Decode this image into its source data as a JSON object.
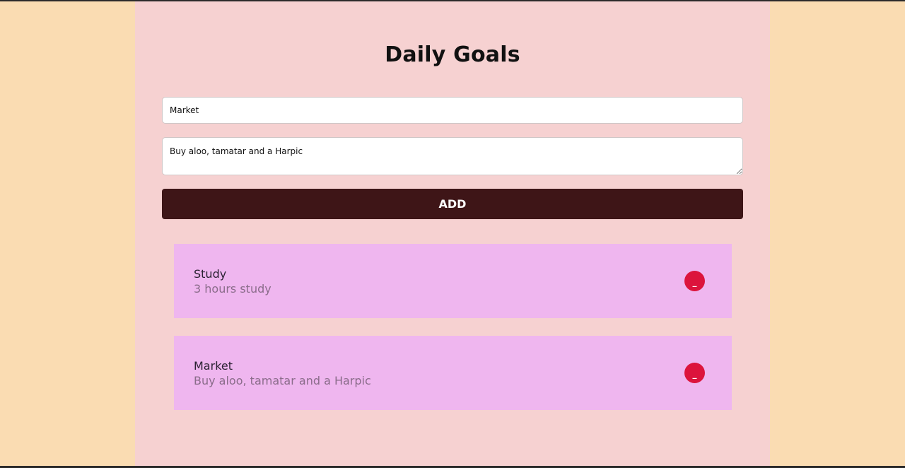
{
  "page": {
    "title": "Daily Goals",
    "colors": {
      "outer_background": "#fadcb2",
      "container_background": "#f6d1d1",
      "add_button": "#3e1517",
      "card_background": "#efb6ef",
      "remove_button": "#dc143c"
    }
  },
  "form": {
    "title_value": "Market",
    "description_value": "Buy aloo, tamatar and a Harpic",
    "add_label": "ADD"
  },
  "goals": [
    {
      "title": "Study",
      "description": "3 hours study",
      "remove_label": "_"
    },
    {
      "title": "Market",
      "description": "Buy aloo, tamatar and a Harpic",
      "remove_label": "_"
    }
  ]
}
